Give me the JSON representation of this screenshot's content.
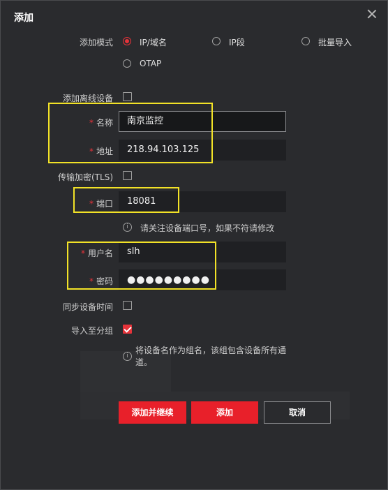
{
  "dialog": {
    "title": "添加"
  },
  "mode": {
    "label": "添加模式",
    "options": [
      "IP/域名",
      "IP段",
      "批量导入",
      "OTAP"
    ],
    "selected": "IP/域名"
  },
  "offline": {
    "label": "添加离线设备",
    "checked": false
  },
  "fields": {
    "name": {
      "label": "名称",
      "value": "南京监控"
    },
    "address": {
      "label": "地址",
      "value": "218.94.103.125"
    },
    "tls": {
      "label": "传输加密(TLS)",
      "checked": false
    },
    "port": {
      "label": "端口",
      "value": "18081"
    },
    "port_hint": "请关注设备端口号，如果不符请修改",
    "username": {
      "label": "用户名",
      "value": "slh"
    },
    "password": {
      "label": "密码",
      "masked": "●●●●●●●●●"
    },
    "sync_time": {
      "label": "同步设备时间",
      "checked": false
    },
    "import_group": {
      "label": "导入至分组",
      "checked": true
    },
    "group_hint": "将设备名作为组名，该组包含设备所有通道。"
  },
  "required_mark": "*",
  "info_glyph": "i",
  "buttons": {
    "add_continue": "添加并继续",
    "add": "添加",
    "cancel": "取消"
  },
  "colors": {
    "accent": "#e8202a",
    "highlight": "#f2e227",
    "background": "#2a2b2e"
  }
}
